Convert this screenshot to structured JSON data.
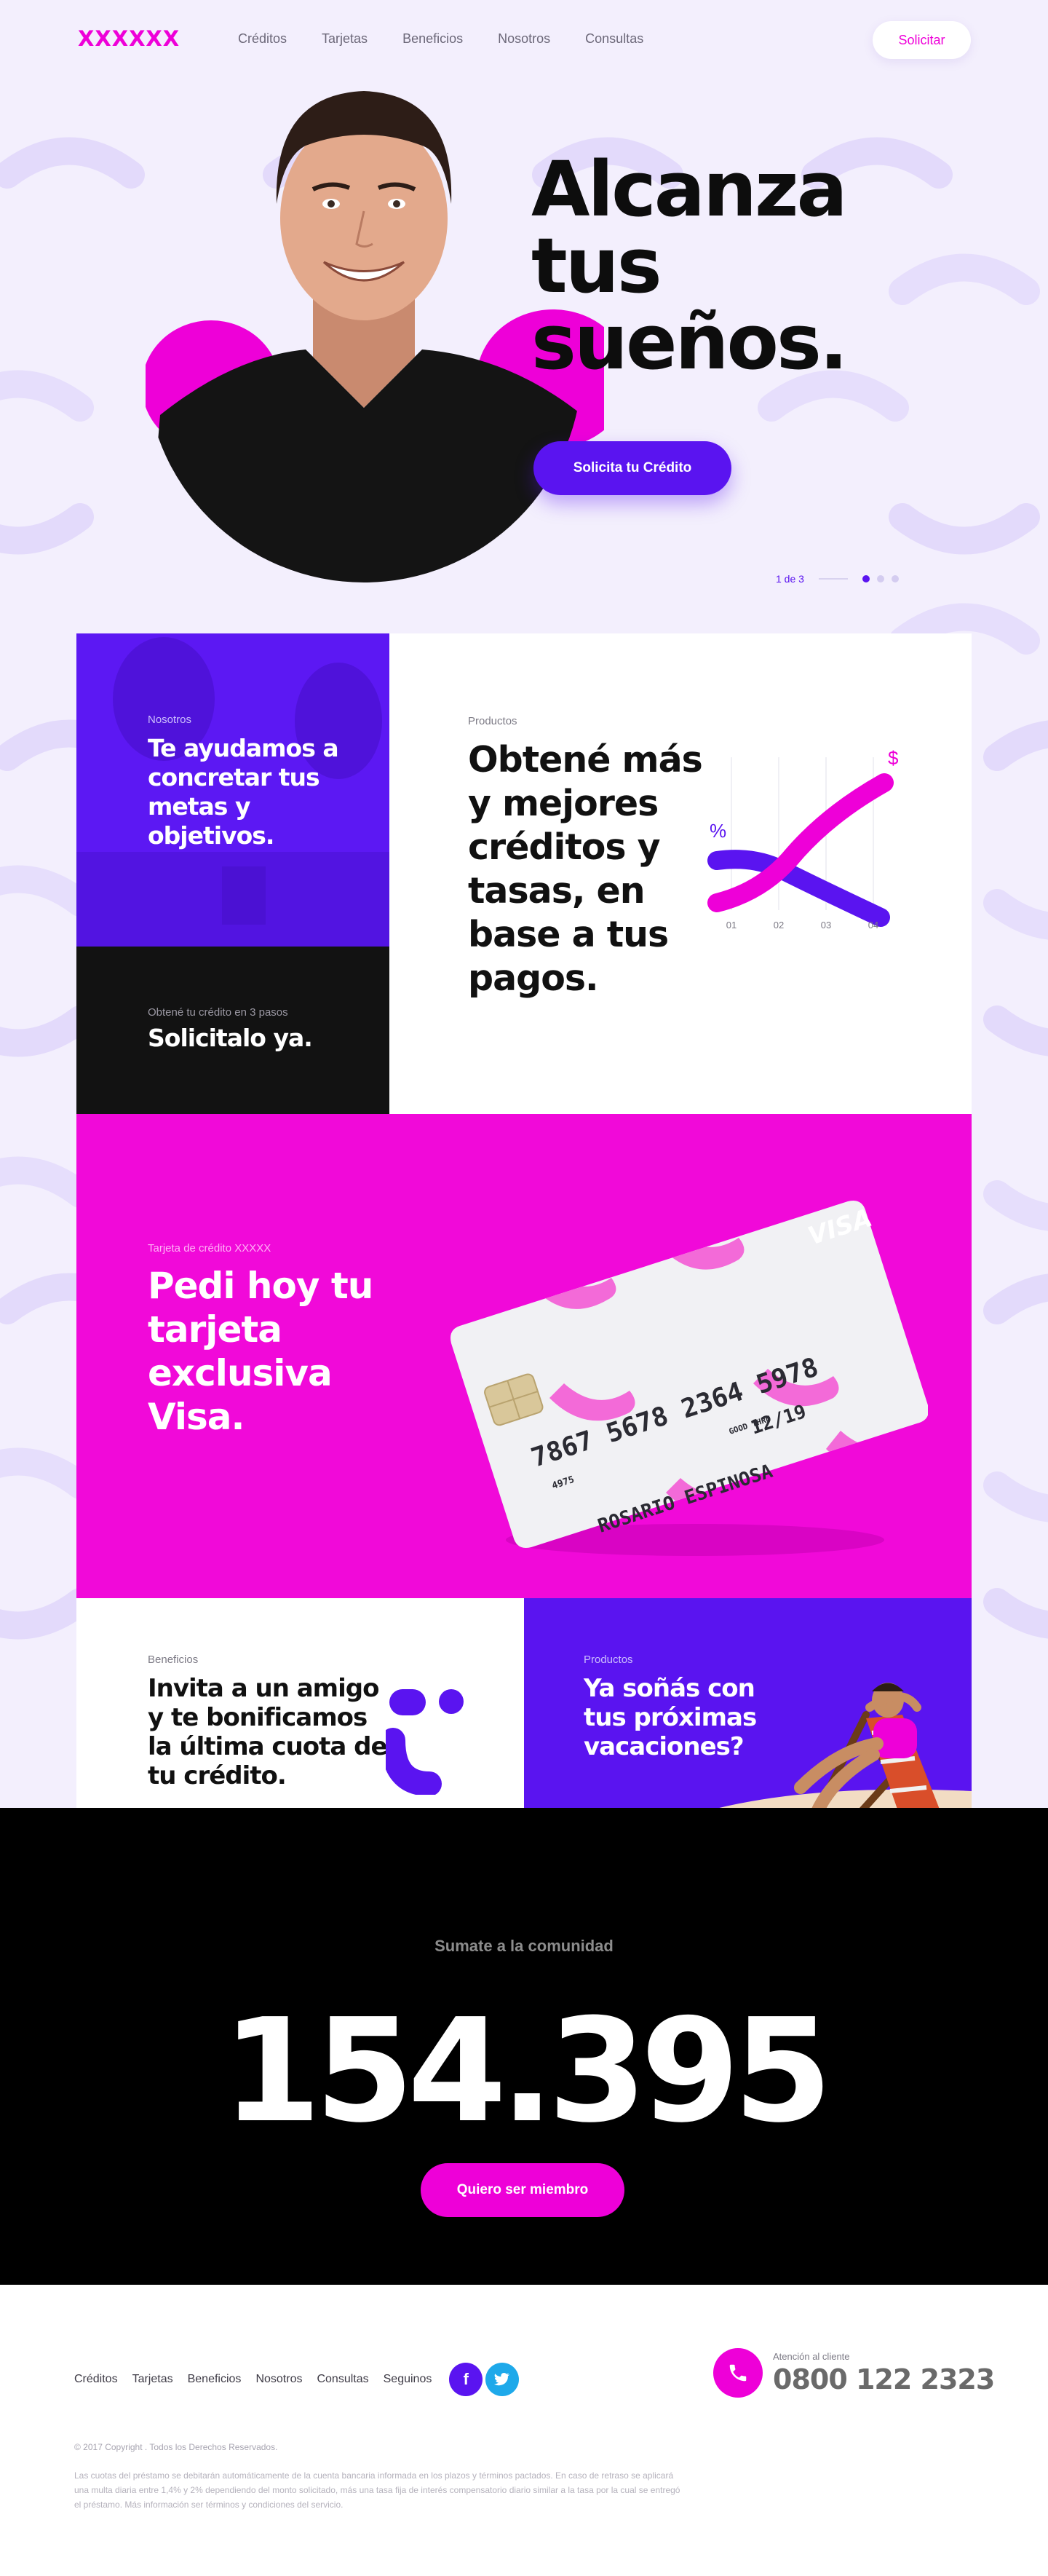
{
  "header": {
    "logo": "XXXXXX",
    "nav": [
      "Créditos",
      "Tarjetas",
      "Beneficios",
      "Nosotros",
      "Consultas"
    ],
    "cta": "Solicitar"
  },
  "hero": {
    "title_lines": [
      "Alcanza",
      "tus",
      "sueños."
    ],
    "cta": "Solicita tu Crédito",
    "pager": "1 de 3",
    "slides": 3,
    "active_slide": 1
  },
  "about": {
    "eyebrow": "Nosotros",
    "title": "Te ayudamos a concretar tus metas y objetivos."
  },
  "steps": {
    "eyebrow": "Obtené tu crédito en 3 pasos",
    "title": "Solicitalo ya."
  },
  "products": {
    "eyebrow": "Productos",
    "title": "Obtené más y mejores créditos y tasas, en base a tus pagos.",
    "chart": {
      "percent_symbol": "%",
      "dollar_symbol": "$",
      "ticks": [
        "01",
        "02",
        "03",
        "04"
      ]
    }
  },
  "card": {
    "eyebrow": "Tarjeta de crédito XXXXX",
    "title": "Pedi hoy tu tarjeta exclusiva Visa.",
    "brand": "VISA",
    "number": "7867 5678 2364 5978",
    "short": "4975",
    "good_thru_label": "GOOD THRU",
    "expiry": "12/19",
    "holder": "ROSARIO ESPINOSA"
  },
  "friend": {
    "eyebrow": "Beneficios",
    "title": "Invita a un amigo y te bonificamos la última cuota de tu crédito."
  },
  "vacations": {
    "eyebrow": "Productos",
    "title": "Ya soñás con tus próximas vacaciones?"
  },
  "community": {
    "label": "Sumate a la comunidad",
    "count": "154.395",
    "cta": "Quiero ser miembro"
  },
  "footer": {
    "nav": [
      "Créditos",
      "Tarjetas",
      "Beneficios",
      "Nosotros",
      "Consultas",
      "Seguinos"
    ],
    "phone_caption": "Atención al cliente",
    "phone": "0800 122 2323",
    "copyright": "© 2017 Copyright . Todos los Derechos Reservados.",
    "legal": "Las cuotas del préstamo se debitarán automáticamente de la cuenta bancaria informada en los plazos y términos pactados. En caso de retraso se aplicará una multa diaria entre 1,4% y 2% dependiendo del monto solicitado, más una tasa fija de interés compensatorio diario similar a la tasa por la cual se entregó el préstamo. Más información ser términos y condiciones del servicio."
  },
  "colors": {
    "magenta": "#ee00d8",
    "violet": "#5a14f0",
    "lavender": "#f3effd",
    "black": "#000000"
  }
}
